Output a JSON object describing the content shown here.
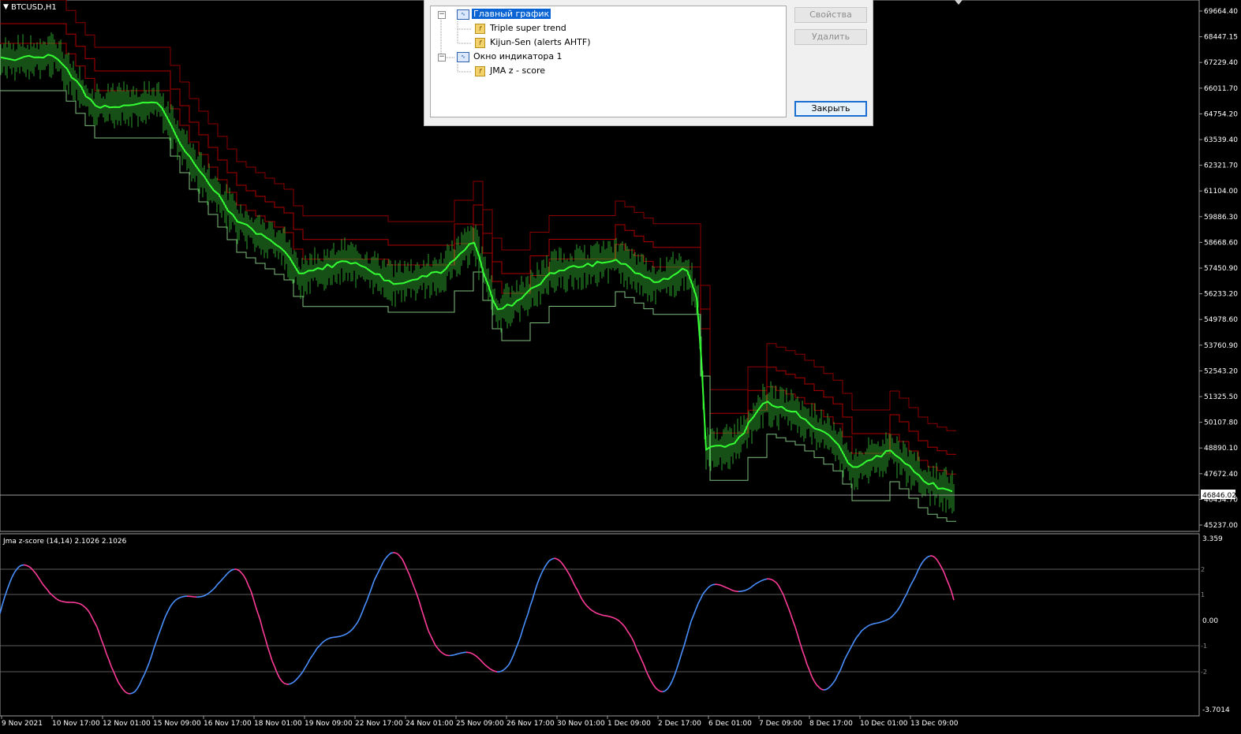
{
  "chart": {
    "symbol_title": "BTCUSD,H1",
    "current_price": "46846.02",
    "price_axis": [
      "69664.40",
      "68447.15",
      "67229.40",
      "66011.70",
      "64754.20",
      "63539.40",
      "62321.70",
      "61104.00",
      "59886.30",
      "58668.60",
      "57450.90",
      "56233.20",
      "54978.60",
      "53760.90",
      "52543.20",
      "51325.50",
      "50107.80",
      "48890.10",
      "47672.40",
      "46454.70",
      "45237.00"
    ],
    "time_axis": [
      "9 Nov 2021",
      "10 Nov 17:00",
      "12 Nov 01:00",
      "15 Nov 09:00",
      "16 Nov 17:00",
      "18 Nov 01:00",
      "19 Nov 09:00",
      "22 Nov 17:00",
      "24 Nov 01:00",
      "25 Nov 09:00",
      "26 Nov 17:00",
      "30 Nov 01:00",
      "1 Dec 09:00",
      "2 Dec 17:00",
      "6 Dec 01:00",
      "7 Dec 09:00",
      "8 Dec 17:00",
      "10 Dec 01:00",
      "13 Dec 09:00"
    ],
    "colors": {
      "background": "#000000",
      "price_bars": "#2ea12e",
      "trend_line": "#33ff33",
      "band": "#8b0000",
      "kijun": "#7fbf7f",
      "zscore_up": "#4a90ff",
      "zscore_down": "#ff3c9a",
      "grid": "#7a7a7a"
    }
  },
  "indicator": {
    "title": "Jma z-score (14,14) 2.1026 2.1026",
    "axis": [
      "3.359",
      "0.00",
      "-3.7014"
    ],
    "levels": [
      "2",
      "1",
      "-1",
      "-2"
    ]
  },
  "dialog": {
    "tree": {
      "main_window": "Главный график",
      "main_items": [
        "Triple super trend",
        "Kijun-Sen (alerts AHTF)"
      ],
      "sub_window": "Окно индикатора 1",
      "sub_items": [
        "JMA  z - score"
      ]
    },
    "buttons": {
      "properties": "Свойства",
      "delete": "Удалить",
      "close": "Закрыть"
    },
    "icons": {
      "window": "chart-window-icon",
      "indicator": "custom-indicator-icon",
      "collapse": "tree-collapse-icon"
    }
  }
}
